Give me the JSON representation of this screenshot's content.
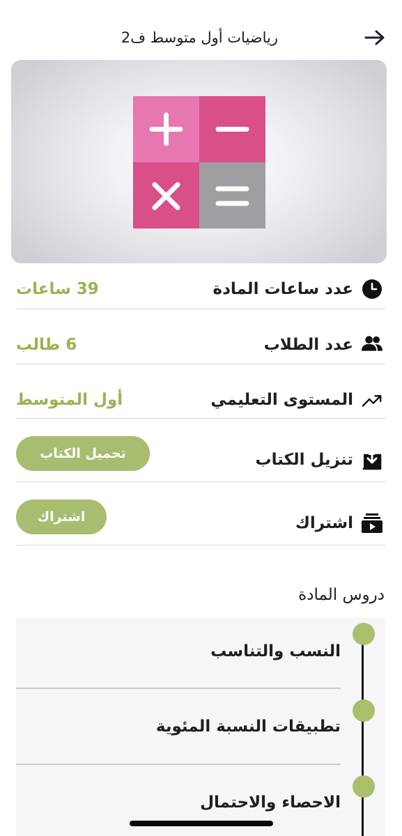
{
  "header": {
    "title": "رياضيات أول متوسط ف2"
  },
  "info": {
    "hours_label": "عدد ساعات المادة",
    "hours_value": "39 ساعات",
    "students_label": "عدد الطلاب",
    "students_value": "6 طالب",
    "level_label": "المستوى التعليمي",
    "level_value": "أول المتوسط",
    "download_label": "تنزيل الكتاب",
    "download_button": "تحميل الكتاب",
    "subscribe_label": "اشتراك",
    "subscribe_button": "اشتراك"
  },
  "lessons": {
    "title": "دروس المادة",
    "items": [
      {
        "label": "النسب والتناسب"
      },
      {
        "label": "تطبيقات النسبة المئوية"
      },
      {
        "label": "الاحصاء والاحتمال"
      }
    ]
  },
  "colors": {
    "accent_green": "#a8bd6f",
    "value_green": "#97b453",
    "calc_pink_light": "#e777b0",
    "calc_pink_dark": "#d94f88",
    "calc_gray": "#9e9ea3"
  },
  "icons": {
    "back": "arrow-right-icon",
    "hours": "clock-icon",
    "students": "users-icon",
    "level": "trending-up-icon",
    "download": "download-box-icon",
    "subscribe": "subscription-icon",
    "hero": "calculator-icon"
  }
}
